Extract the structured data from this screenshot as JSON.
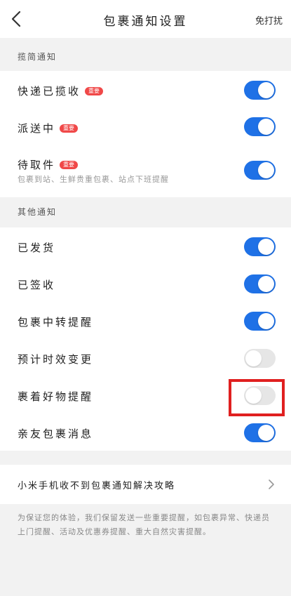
{
  "header": {
    "title": "包裹通知设置",
    "action_label": "免打扰"
  },
  "sections": {
    "courier": {
      "label": "揽简通知",
      "items": [
        {
          "label": "快递已揽收",
          "badge": "重要",
          "enabled": true
        },
        {
          "label": "派送中",
          "badge": "重要",
          "enabled": true
        },
        {
          "label": "待取件",
          "badge": "重要",
          "subtitle": "包裹到站、生鲜贵重包裹、站点下班提醒",
          "enabled": true
        }
      ]
    },
    "other": {
      "label": "其他通知",
      "items": [
        {
          "label": "已发货",
          "enabled": true
        },
        {
          "label": "已签收",
          "enabled": true
        },
        {
          "label": "包裹中转提醒",
          "enabled": true
        },
        {
          "label": "预计时效变更",
          "enabled": false
        },
        {
          "label": "裹着好物提醒",
          "enabled": false
        },
        {
          "label": "亲友包裹消息",
          "enabled": true
        }
      ]
    }
  },
  "help_link": {
    "label": "小米手机收不到包裹通知解决攻略"
  },
  "footer": {
    "note": "为保证您的体验，我们保留发送一些重要提醒，如包裹异常、快递员上门提醒、活动及优惠券提醒、重大自然灾害提醒。"
  },
  "colors": {
    "toggle_on": "#1f71e6",
    "toggle_off": "#e6e6e6",
    "badge": "#f04848",
    "highlight": "#e02020"
  }
}
